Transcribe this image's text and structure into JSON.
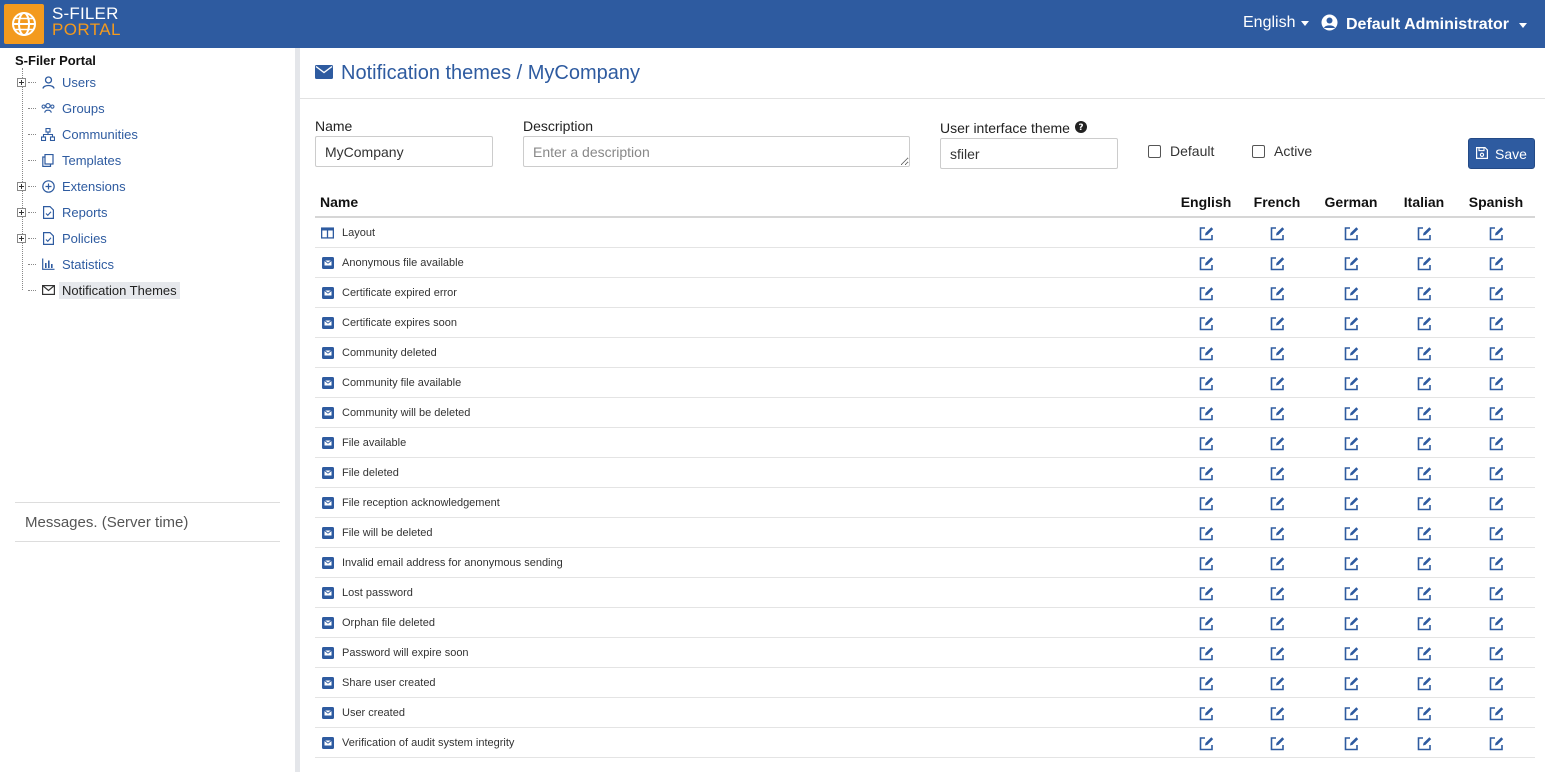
{
  "header": {
    "logo_line1": "S-FILER",
    "logo_line2": "PORTAL",
    "language": "English",
    "user_name": "Default Administrator",
    "bar_color": "#2e5ba0",
    "accent_color": "#f39a1e"
  },
  "sidebar": {
    "root": "S-Filer Portal",
    "items": [
      {
        "label": "Users",
        "icon": "user-icon",
        "expandable": true
      },
      {
        "label": "Groups",
        "icon": "users-group-icon",
        "expandable": false
      },
      {
        "label": "Communities",
        "icon": "sitemap-icon",
        "expandable": false
      },
      {
        "label": "Templates",
        "icon": "copy-icon",
        "expandable": false
      },
      {
        "label": "Extensions",
        "icon": "plus-circle-icon",
        "expandable": true
      },
      {
        "label": "Reports",
        "icon": "report-file-icon",
        "expandable": true
      },
      {
        "label": "Policies",
        "icon": "policy-file-icon",
        "expandable": true
      },
      {
        "label": "Statistics",
        "icon": "bar-chart-icon",
        "expandable": false
      },
      {
        "label": "Notification Themes",
        "icon": "envelope-icon",
        "expandable": false,
        "selected": true
      }
    ],
    "messages_label": "Messages. (Server time)"
  },
  "main": {
    "title": "Notification themes / MyCompany",
    "form": {
      "name_label": "Name",
      "name_value": "MyCompany",
      "description_label": "Description",
      "description_placeholder": "Enter a description",
      "ui_theme_label": "User interface theme",
      "ui_theme_value": "sfiler",
      "default_label": "Default",
      "active_label": "Active",
      "save_label": "Save"
    },
    "table": {
      "name_header": "Name",
      "languages": [
        "English",
        "French",
        "German",
        "Italian",
        "Spanish"
      ],
      "rows": [
        {
          "name": "Layout",
          "icon": "layout-icon"
        },
        {
          "name": "Anonymous file available",
          "icon": "envelope-square-icon"
        },
        {
          "name": "Certificate expired error",
          "icon": "envelope-square-icon"
        },
        {
          "name": "Certificate expires soon",
          "icon": "envelope-square-icon"
        },
        {
          "name": "Community deleted",
          "icon": "envelope-square-icon"
        },
        {
          "name": "Community file available",
          "icon": "envelope-square-icon"
        },
        {
          "name": "Community will be deleted",
          "icon": "envelope-square-icon"
        },
        {
          "name": "File available",
          "icon": "envelope-square-icon"
        },
        {
          "name": "File deleted",
          "icon": "envelope-square-icon"
        },
        {
          "name": "File reception acknowledgement",
          "icon": "envelope-square-icon"
        },
        {
          "name": "File will be deleted",
          "icon": "envelope-square-icon"
        },
        {
          "name": "Invalid email address for anonymous sending",
          "icon": "envelope-square-icon"
        },
        {
          "name": "Lost password",
          "icon": "envelope-square-icon"
        },
        {
          "name": "Orphan file deleted",
          "icon": "envelope-square-icon"
        },
        {
          "name": "Password will expire soon",
          "icon": "envelope-square-icon"
        },
        {
          "name": "Share user created",
          "icon": "envelope-square-icon"
        },
        {
          "name": "User created",
          "icon": "envelope-square-icon"
        },
        {
          "name": "Verification of audit system integrity",
          "icon": "envelope-square-icon"
        }
      ]
    }
  }
}
